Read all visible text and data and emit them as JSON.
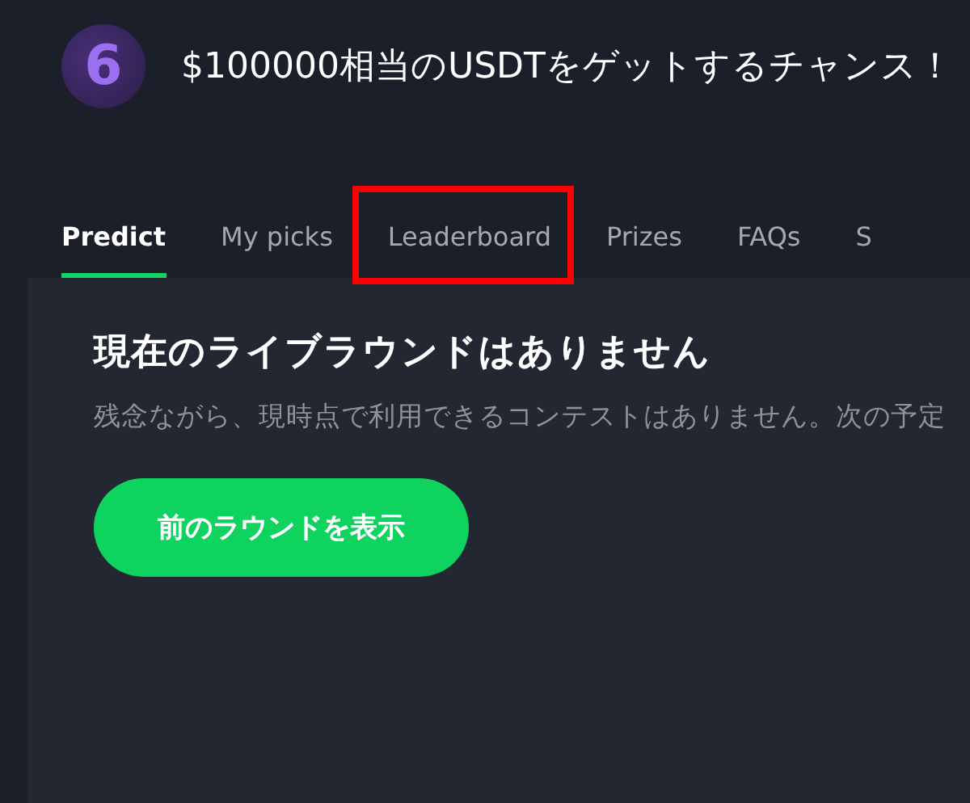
{
  "header": {
    "logo_text": "6",
    "title": "$100000相当のUSDTをゲットするチャンス！"
  },
  "tabs": [
    {
      "label": "Predict",
      "selected": true,
      "highlighted": false
    },
    {
      "label": "My picks",
      "selected": false,
      "highlighted": false
    },
    {
      "label": "Leaderboard",
      "selected": false,
      "highlighted": true
    },
    {
      "label": "Prizes",
      "selected": false,
      "highlighted": false
    },
    {
      "label": "FAQs",
      "selected": false,
      "highlighted": false
    },
    {
      "label": "S",
      "selected": false,
      "highlighted": false
    }
  ],
  "panel": {
    "heading": "現在のライブラウンドはありません",
    "description": "残念ながら、現時点で利用できるコンテストはありません。次の予定",
    "button": "前のラウンドを表示"
  }
}
